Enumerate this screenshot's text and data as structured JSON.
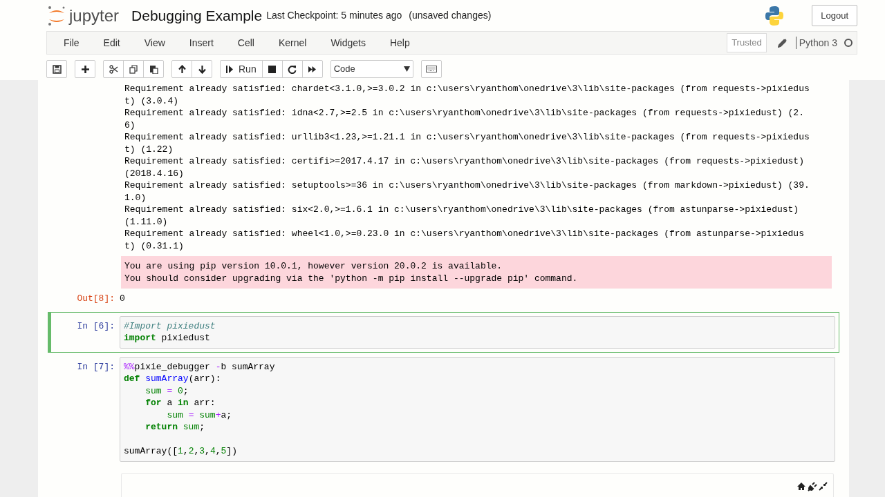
{
  "header": {
    "logo_text": "jupyter",
    "notebook_title": "Debugging Example",
    "checkpoint": "Last Checkpoint: 5 minutes ago",
    "unsaved": "(unsaved changes)",
    "logout": "Logout"
  },
  "menubar": {
    "menus": [
      "File",
      "Edit",
      "View",
      "Insert",
      "Cell",
      "Kernel",
      "Widgets",
      "Help"
    ],
    "trusted": "Trusted",
    "kernel_name": "Python 3",
    "kernel_busy": false
  },
  "toolbar": {
    "groups": [
      [
        {
          "kind": "save"
        }
      ],
      [
        {
          "kind": "plus"
        }
      ],
      [
        {
          "kind": "cut"
        },
        {
          "kind": "copy"
        },
        {
          "kind": "paste"
        }
      ],
      [
        {
          "kind": "up"
        },
        {
          "kind": "down"
        }
      ],
      [
        {
          "kind": "run",
          "label": "Run"
        },
        {
          "kind": "stop"
        },
        {
          "kind": "restart"
        },
        {
          "kind": "fastforward"
        }
      ]
    ],
    "cell_type": "Code"
  },
  "cells": [
    {
      "kind": "output",
      "stdout": [
        "Requirement already satisfied: chardet<3.1.0,>=3.0.2 in c:\\users\\ryanthom\\onedrive\\3\\lib\\site-packages (from requests->pixiedust) (3.0.4)",
        "Requirement already satisfied: idna<2.7,>=2.5 in c:\\users\\ryanthom\\onedrive\\3\\lib\\site-packages (from requests->pixiedust) (2.6)",
        "Requirement already satisfied: urllib3<1.23,>=1.21.1 in c:\\users\\ryanthom\\onedrive\\3\\lib\\site-packages (from requests->pixiedust) (1.22)",
        "Requirement already satisfied: certifi>=2017.4.17 in c:\\users\\ryanthom\\onedrive\\3\\lib\\site-packages (from requests->pixiedust) (2018.4.16)",
        "Requirement already satisfied: setuptools>=36 in c:\\users\\ryanthom\\onedrive\\3\\lib\\site-packages (from markdown->pixiedust) (39.1.0)",
        "Requirement already satisfied: six<2.0,>=1.6.1 in c:\\users\\ryanthom\\onedrive\\3\\lib\\site-packages (from astunparse->pixiedust) (1.11.0)",
        "Requirement already satisfied: wheel<1.0,>=0.23.0 in c:\\users\\ryanthom\\onedrive\\3\\lib\\site-packages (from astunparse->pixiedust) (0.31.1)"
      ],
      "stderr": [
        "You are using pip version 10.0.1, however version 20.0.2 is available.",
        "You should consider upgrading via the 'python -m pip install --upgrade pip' command."
      ]
    },
    {
      "kind": "result",
      "prompt": "Out[8]:",
      "value": "0"
    },
    {
      "kind": "code",
      "prompt": "In [6]:",
      "selected": true,
      "lines": [
        {
          "tokens": [
            {
              "t": "#Import pixiedust",
              "kind": "comment"
            }
          ]
        },
        {
          "tokens": [
            {
              "t": "import",
              "kind": "keyword"
            },
            {
              "t": " pixiedust",
              "kind": "plain"
            }
          ]
        }
      ]
    },
    {
      "kind": "code",
      "prompt": "In [7]:",
      "selected": false,
      "lines": [
        {
          "tokens": [
            {
              "t": "%%",
              "kind": "magic"
            },
            {
              "t": "pixie_debugger ",
              "kind": "plain"
            },
            {
              "t": "-",
              "kind": "op"
            },
            {
              "t": "b sumArray",
              "kind": "plain"
            }
          ]
        },
        {
          "tokens": [
            {
              "t": "def",
              "kind": "keyword"
            },
            {
              "t": " sumArray",
              "kind": "def"
            },
            {
              "t": "(arr):",
              "kind": "plain"
            }
          ]
        },
        {
          "tokens": [
            {
              "t": "    sum",
              "kind": "builtin"
            },
            {
              "t": " =",
              "kind": "op"
            },
            {
              "t": " 0",
              "kind": "number"
            },
            {
              "t": ";",
              "kind": "plain"
            }
          ]
        },
        {
          "tokens": [
            {
              "t": "    for",
              "kind": "keyword"
            },
            {
              "t": " a ",
              "kind": "plain"
            },
            {
              "t": "in",
              "kind": "keyword"
            },
            {
              "t": " arr:",
              "kind": "plain"
            }
          ]
        },
        {
          "tokens": [
            {
              "t": "        sum",
              "kind": "builtin"
            },
            {
              "t": " =",
              "kind": "op"
            },
            {
              "t": " sum",
              "kind": "builtin"
            },
            {
              "t": "+",
              "kind": "op"
            },
            {
              "t": "a;",
              "kind": "plain"
            }
          ]
        },
        {
          "tokens": [
            {
              "t": "    return",
              "kind": "keyword"
            },
            {
              "t": " sum",
              "kind": "builtin"
            },
            {
              "t": ";",
              "kind": "plain"
            }
          ]
        },
        {
          "blank_before": true,
          "tokens": [
            {
              "t": "sumArray([",
              "kind": "plain"
            },
            {
              "t": "1",
              "kind": "number"
            },
            {
              "t": ",",
              "kind": "plain"
            },
            {
              "t": "2",
              "kind": "number"
            },
            {
              "t": ",",
              "kind": "plain"
            },
            {
              "t": "3",
              "kind": "number"
            },
            {
              "t": ",",
              "kind": "plain"
            },
            {
              "t": "4",
              "kind": "number"
            },
            {
              "t": ",",
              "kind": "plain"
            },
            {
              "t": "5",
              "kind": "number"
            },
            {
              "t": "])",
              "kind": "plain"
            }
          ]
        }
      ]
    },
    {
      "kind": "debugger_panel"
    }
  ]
}
